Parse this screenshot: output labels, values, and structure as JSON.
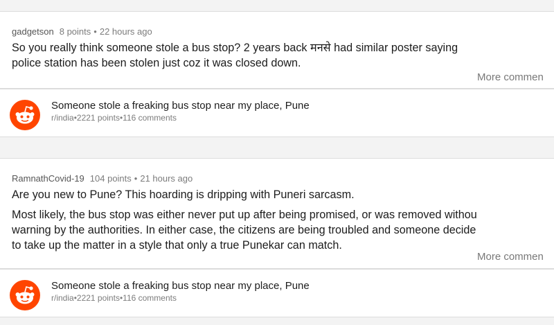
{
  "comments": [
    {
      "author": "gadgetson",
      "points": "8 points",
      "time": "22 hours ago",
      "paragraphs": [
        [
          "So you really think someone stole a bus stop? 2 years back मनसे had similar poster saying",
          "police station has been stolen just coz it was closed down."
        ]
      ],
      "more_label": "More commen"
    },
    {
      "author": "RamnathCovid-19",
      "points": "104 points",
      "time": "21 hours ago",
      "paragraphs": [
        [
          "Are you new to Pune? This hoarding is dripping with Puneri sarcasm."
        ],
        [
          "Most likely, the bus stop was either never put up after being promised, or was removed withou",
          "warning by the authorities. In either case, the citizens are being troubled and someone decide",
          "to take up the matter in a style that only a true Punekar can match."
        ]
      ],
      "more_label": "More commen"
    }
  ],
  "post": {
    "title": "Someone stole a freaking bus stop near my place, Pune",
    "subreddit": "r/india",
    "points": "2221 points",
    "comments": "116 comments",
    "icon": "reddit-snoo-icon",
    "icon_color": "#ff4500"
  },
  "separator": "•"
}
